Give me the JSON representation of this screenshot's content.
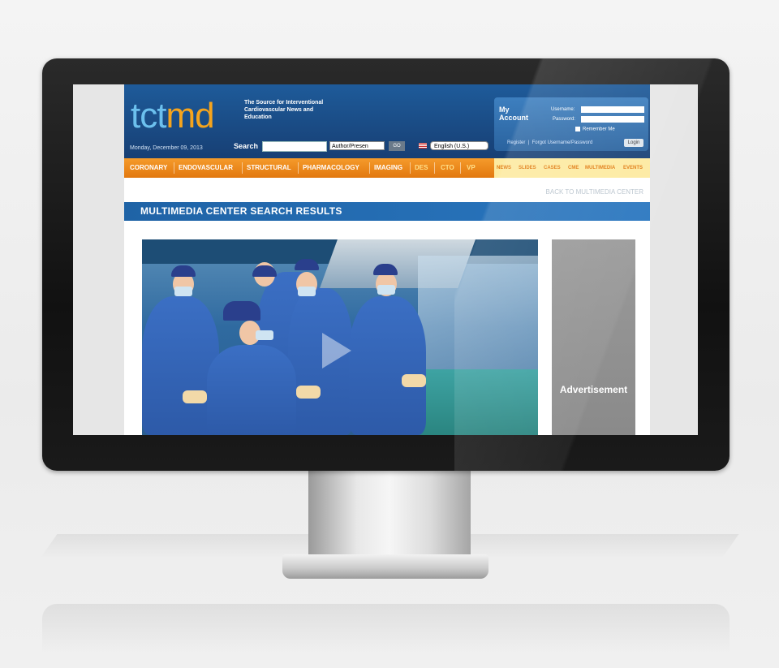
{
  "site": {
    "logo_part1": "tct",
    "logo_part2": "md",
    "tagline": "The Source for Interventional Cardiovascular News and Education",
    "date": "Monday, December 09, 2013"
  },
  "search": {
    "label": "Search",
    "value": "",
    "type_select": "Author/Presen",
    "go_label": "GO",
    "language": "English (U.S.)"
  },
  "account": {
    "title": "My Account",
    "username_label": "Username:",
    "password_label": "Password:",
    "remember_label": "Remember Me",
    "register_label": "Register",
    "forgot_label": "Forgot Username/Password",
    "login_label": "Login"
  },
  "nav": {
    "items": [
      "CORONARY",
      "ENDOVASCULAR",
      "STRUCTURAL",
      "PHARMACOLOGY",
      "IMAGING",
      "DES",
      "CTO",
      "VP"
    ],
    "secondary": [
      "NEWS",
      "SLIDES",
      "CASES",
      "CME",
      "MULTIMEDIA",
      "EVENTS"
    ]
  },
  "main": {
    "back_prefix": "BACK",
    "back_link": "TO MULTIMEDIA CENTER",
    "results_title": "MULTIMEDIA CENTER SEARCH RESULTS",
    "ad_label": "Advertisement"
  },
  "colors": {
    "header_blue": "#1e5b9a",
    "nav_orange": "#f59b2b",
    "logo_blue": "#6cc0ee",
    "logo_orange": "#f5a41d",
    "results_bar": "#1f63a6",
    "ad_gray": "#9a9a9a"
  }
}
